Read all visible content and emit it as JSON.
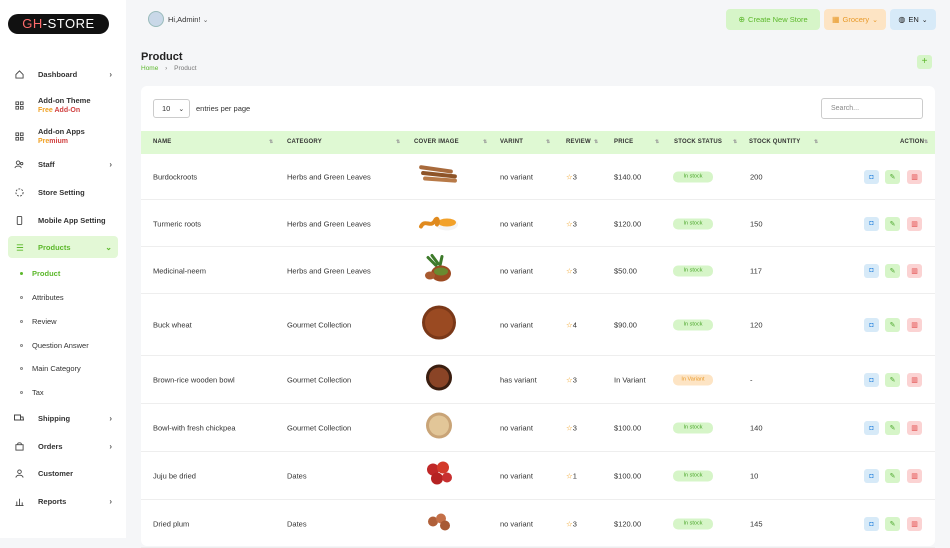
{
  "brand": {
    "logo_a": "GH",
    "logo_b": "-STORE"
  },
  "sidebar": {
    "items": [
      {
        "label": "Dashboard"
      },
      {
        "label": "Add-on Theme",
        "sub_a": "Free",
        "sub_b": " Add-On"
      },
      {
        "label": "Add-on Apps",
        "sub_a": "Pre",
        "sub_b": "mium"
      },
      {
        "label": "Staff"
      },
      {
        "label": "Store Setting"
      },
      {
        "label": "Mobile App Setting"
      },
      {
        "label": "Products"
      },
      {
        "label": "Shipping"
      },
      {
        "label": "Orders"
      },
      {
        "label": "Customer"
      },
      {
        "label": "Reports"
      }
    ],
    "subitems": [
      "Product",
      "Attributes",
      "Review",
      "Question Answer",
      "Main Category",
      "Tax"
    ]
  },
  "header": {
    "greeting": "Hi,Admin!",
    "create_store": "Create New Store",
    "store_type": "Grocery",
    "language": "EN"
  },
  "page": {
    "title": "Product",
    "crumb_home": "Home",
    "crumb_current": "Product",
    "add_symbol": "+"
  },
  "table_controls": {
    "entries_value": "10",
    "entries_label": "entries per page",
    "search_placeholder": "Search..."
  },
  "columns": [
    "NAME",
    "CATEGORY",
    "COVER IMAGE",
    "VARINT",
    "REVIEW",
    "PRICE",
    "STOCK STATUS",
    "STOCK QUNTITY",
    "ACTION"
  ],
  "rows": [
    {
      "name": "Burdockroots",
      "category": "Herbs and Green Leaves",
      "variant": "no variant",
      "review": "3",
      "price": "$140.00",
      "status": "In stock",
      "qty": "200",
      "img": "roots"
    },
    {
      "name": "Turmeric roots",
      "category": "Herbs and Green Leaves",
      "variant": "no variant",
      "review": "3",
      "price": "$120.00",
      "status": "In stock",
      "qty": "150",
      "img": "turmeric"
    },
    {
      "name": "Medicinal-neem",
      "category": "Herbs and Green Leaves",
      "variant": "no variant",
      "review": "3",
      "price": "$50.00",
      "status": "In stock",
      "qty": "117",
      "img": "neem"
    },
    {
      "name": "Buck wheat",
      "category": "Gourmet Collection",
      "variant": "no variant",
      "review": "4",
      "price": "$90.00",
      "status": "In stock",
      "qty": "120",
      "img": "buckwheat"
    },
    {
      "name": "Brown-rice wooden bowl",
      "category": "Gourmet Collection",
      "variant": "has variant",
      "review": "3",
      "price": "In Variant",
      "status": "In Variant",
      "qty": "-",
      "img": "rice"
    },
    {
      "name": "Bowl-with fresh chickpea",
      "category": "Gourmet Collection",
      "variant": "no variant",
      "review": "3",
      "price": "$100.00",
      "status": "In stock",
      "qty": "140",
      "img": "chickpea"
    },
    {
      "name": "Juju be dried",
      "category": "Dates",
      "variant": "no variant",
      "review": "1",
      "price": "$100.00",
      "status": "In stock",
      "qty": "10",
      "img": "jujube"
    },
    {
      "name": "Dried plum",
      "category": "Dates",
      "variant": "no variant",
      "review": "3",
      "price": "$120.00",
      "status": "In stock",
      "qty": "145",
      "img": "plum"
    }
  ],
  "colors": {
    "accent": "#5cb82b",
    "header_bg": "#dff9d3",
    "warn": "#e89a2a",
    "danger": "#e04040",
    "info": "#3a8ee0"
  }
}
